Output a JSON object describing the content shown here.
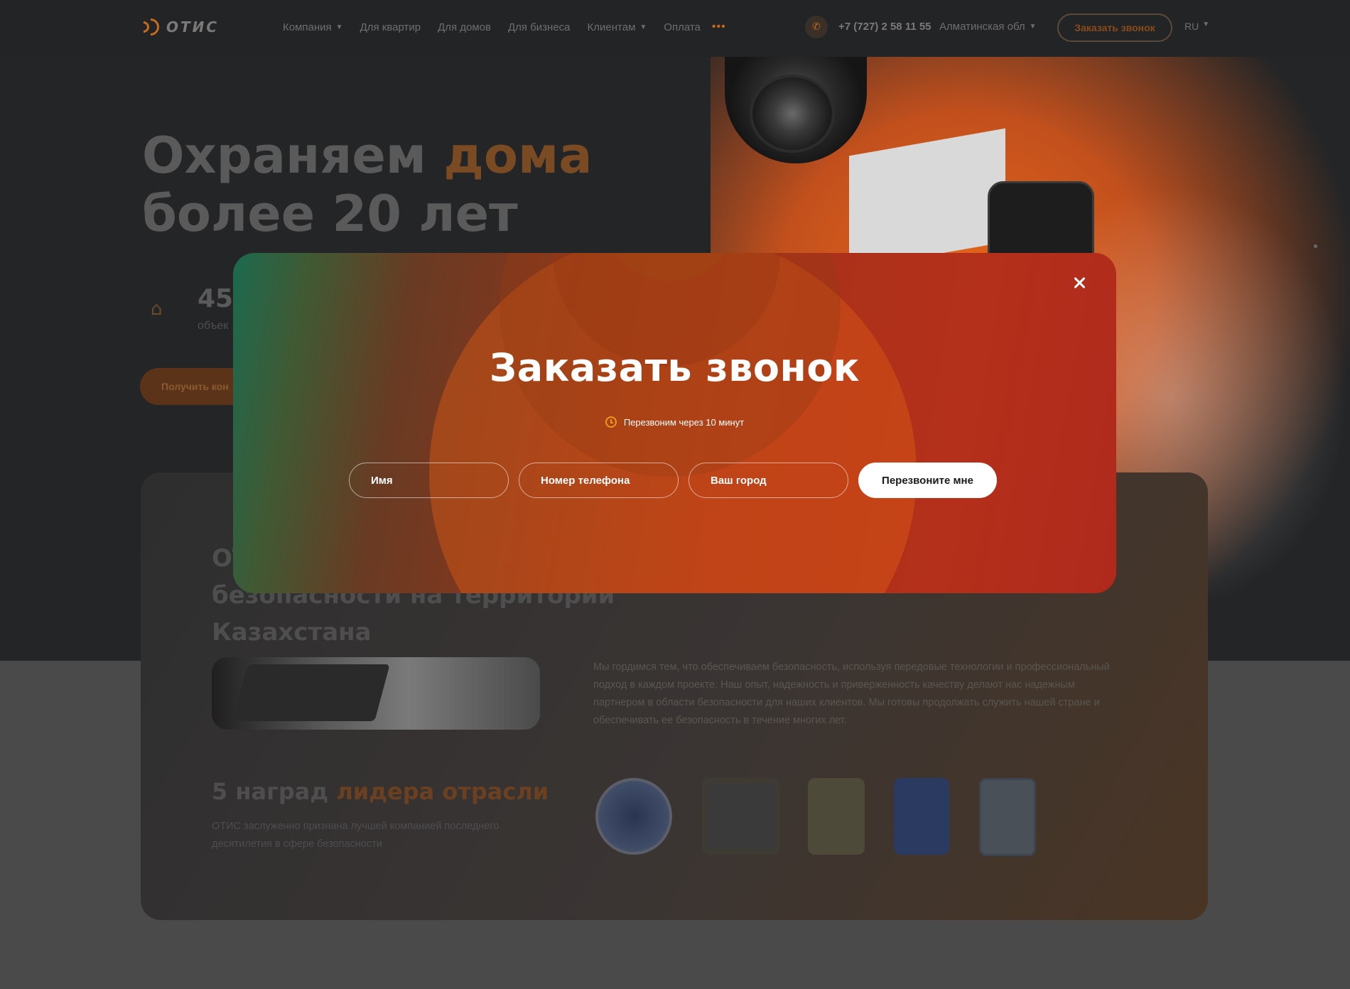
{
  "header": {
    "logo_text": "ОТИС",
    "nav": [
      {
        "label": "Компания",
        "has_dropdown": true
      },
      {
        "label": "Для квартир",
        "has_dropdown": false
      },
      {
        "label": "Для домов",
        "has_dropdown": false
      },
      {
        "label": "Для бизнеса",
        "has_dropdown": false
      },
      {
        "label": "Клиентам",
        "has_dropdown": true
      },
      {
        "label": "Оплата",
        "has_dropdown": false
      }
    ],
    "more_dots": "•••",
    "phone": "+7 (727) 2 58 11 55",
    "region": "Алматинская обл",
    "cta_label": "Заказать звонок",
    "lang": "RU"
  },
  "hero": {
    "title_line1_plain": "Охраняем ",
    "title_line1_accent": "дома",
    "title_line2": "более 20 лет",
    "stat_number": "45",
    "stat_label": "объек",
    "button_label": "Получить кон"
  },
  "about": {
    "title": "ОТ\nбезопасности на территории Казахстана",
    "text": "Мы гордимся тем, что обеспечиваем безопасность, используя передовые технологии и профессиональный подход в каждом проекте. Наш опыт, надежность и приверженность качеству делают нас надежным партнером в области безопасности для наших клиентов. Мы готовы продолжать служить нашей стране и обеспечивать ее безопасность в течение многих лет.",
    "awards_title_plain": "5 наград ",
    "awards_title_accent": "лидера отрасли",
    "awards_text": "ОТИС заслуженно признана лучшей компанией последнего десятилетия в сфере безопасности"
  },
  "modal": {
    "title": "Заказать звонок",
    "note": "Перезвоним через 10 минут",
    "fields": {
      "name_placeholder": "Имя",
      "phone_placeholder": "Номер телефона",
      "city_placeholder": "Ваш город"
    },
    "submit_label": "Перезвоните мне"
  },
  "colors": {
    "accent": "#f0961e",
    "modal_start": "#1c6a4f",
    "modal_end": "#b02a1c",
    "background": "#242526"
  }
}
